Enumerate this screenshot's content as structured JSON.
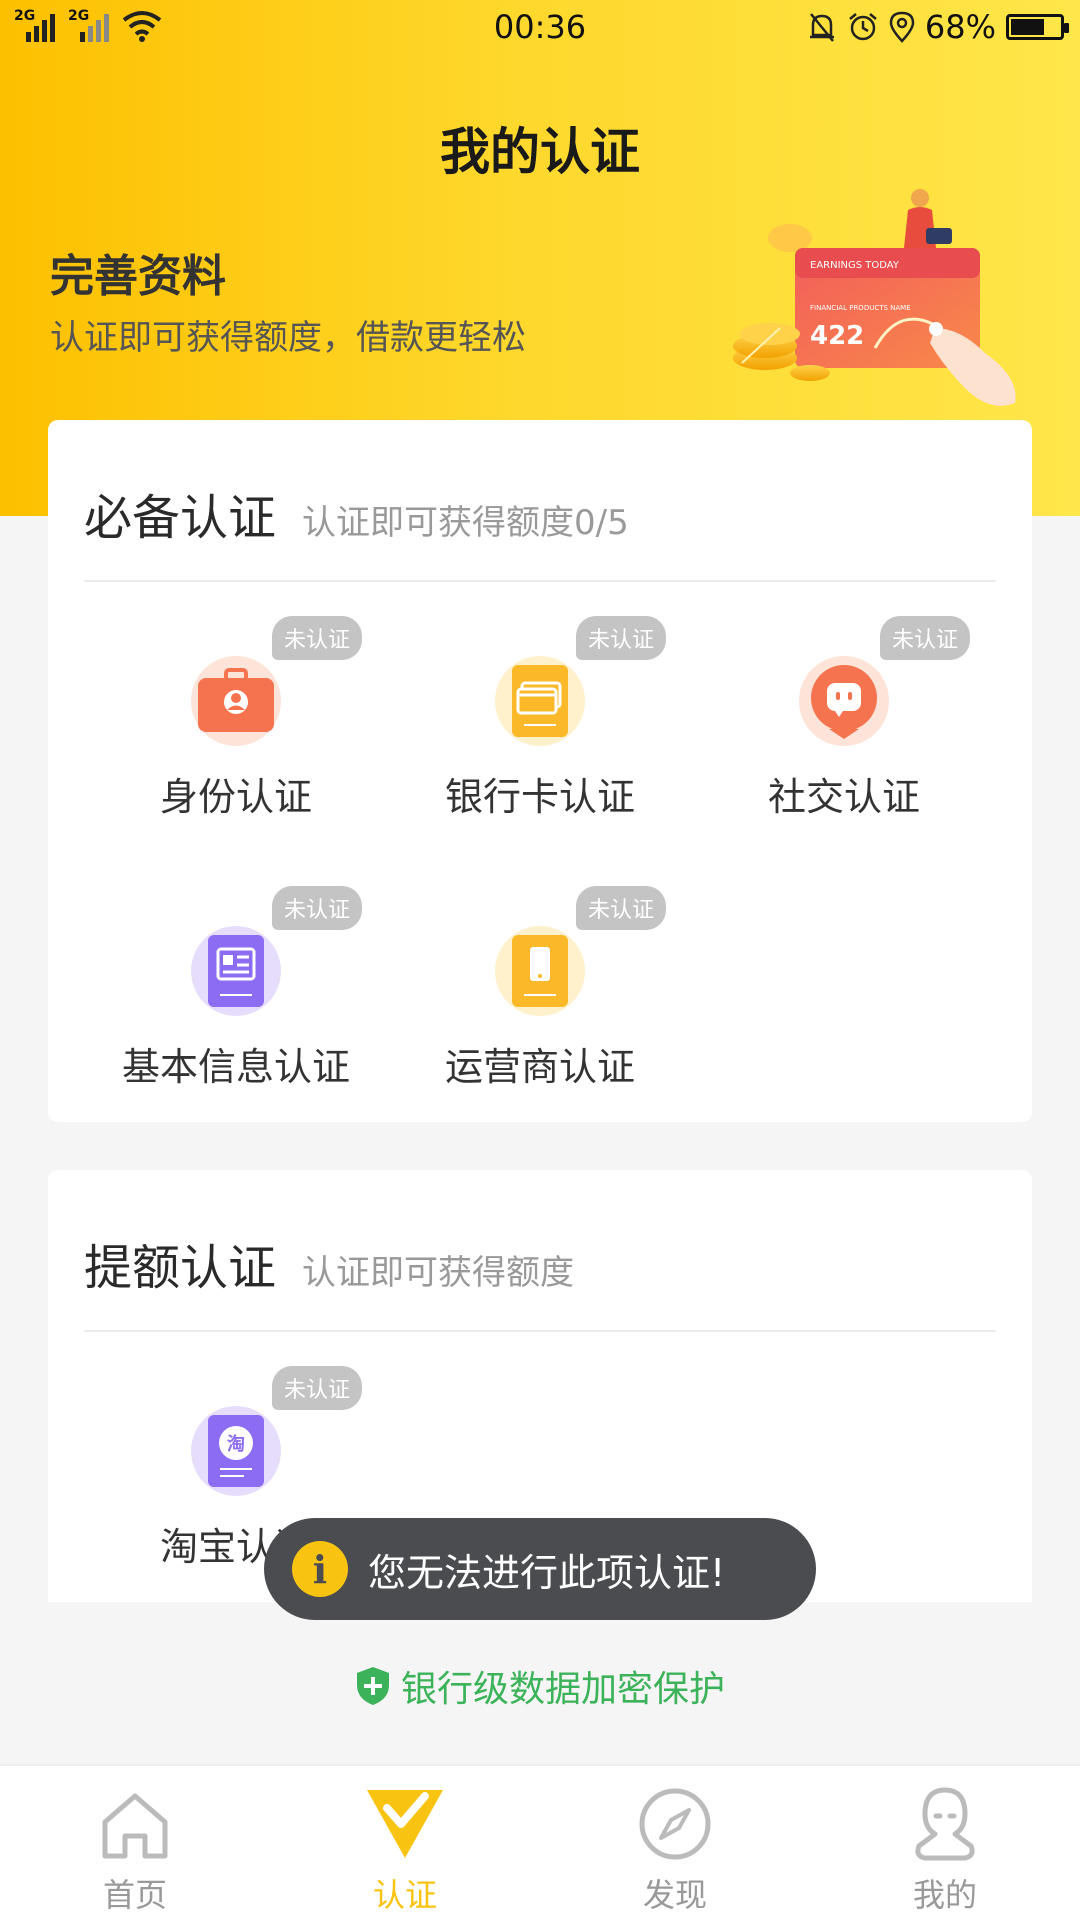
{
  "status_bar": {
    "sim1": "2G",
    "sim2": "2G",
    "time": "00:36",
    "battery": "68%",
    "battery_level": 0.68,
    "icons": [
      "signal-icon",
      "wifi-icon",
      "mute-bell-icon",
      "alarm-icon",
      "location-icon",
      "battery-icon"
    ]
  },
  "header": {
    "title": "我的认证",
    "hero_title": "完善资料",
    "hero_subtitle": "认证即可获得额度，借款更轻松",
    "illustration": {
      "card_line1": "EARNINGS TODAY",
      "card_line2": "FINANCIAL PRODUCTS NAME",
      "card_value": "422"
    }
  },
  "required_section": {
    "title": "必备认证",
    "subtitle": "认证即可获得额度0/5",
    "items": [
      {
        "label": "身份认证",
        "badge": "未认证",
        "icon": "id-badge-icon",
        "color": "#f5734e"
      },
      {
        "label": "银行卡认证",
        "badge": "未认证",
        "icon": "bank-card-icon",
        "color": "#fbb829"
      },
      {
        "label": "社交认证",
        "badge": "未认证",
        "icon": "chat-bubble-icon",
        "color": "#f5734e"
      },
      {
        "label": "基本信息认证",
        "badge": "未认证",
        "icon": "info-doc-icon",
        "color": "#8b6cf2"
      },
      {
        "label": "运营商认证",
        "badge": "未认证",
        "icon": "phone-icon",
        "color": "#fbb829"
      }
    ]
  },
  "boost_section": {
    "title": "提额认证",
    "subtitle": "认证即可获得额度",
    "items": [
      {
        "label": "淘宝认证",
        "badge": "未认证",
        "icon": "taobao-icon",
        "icon_text": "淘",
        "color": "#8b6cf2"
      }
    ]
  },
  "toast": {
    "icon_glyph": "i",
    "message": "您无法进行此项认证!"
  },
  "security_note": "银行级数据加密保护",
  "tabs": [
    {
      "label": "首页",
      "icon": "home-icon",
      "active": false
    },
    {
      "label": "认证",
      "icon": "verify-check-icon",
      "active": true
    },
    {
      "label": "发现",
      "icon": "compass-icon",
      "active": false
    },
    {
      "label": "我的",
      "icon": "profile-icon",
      "active": false
    }
  ],
  "colors": {
    "accent": "#f9c411",
    "badge_bg": "#c4c4c4",
    "security_green": "#3cb35a",
    "toast_bg": "#4a4c50"
  }
}
